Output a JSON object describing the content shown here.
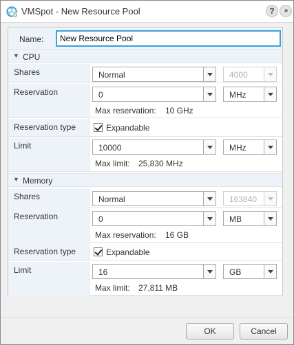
{
  "window": {
    "title": "VMSpot - New Resource Pool",
    "help_label": "?",
    "expand_label": "»"
  },
  "name_field": {
    "label": "Name:",
    "value": "New Resource Pool"
  },
  "cpu": {
    "title": "CPU",
    "shares_label": "Shares",
    "shares_value": "Normal",
    "shares_number": "4000",
    "reservation_label": "Reservation",
    "reservation_value": "0",
    "reservation_unit": "MHz",
    "max_reservation_label": "Max reservation:",
    "max_reservation_value": "10 GHz",
    "reservation_type_label": "Reservation type",
    "expandable_label": "Expandable",
    "expandable_checked": true,
    "limit_label": "Limit",
    "limit_value": "10000",
    "limit_unit": "MHz",
    "max_limit_label": "Max limit:",
    "max_limit_value": "25,830 MHz"
  },
  "memory": {
    "title": "Memory",
    "shares_label": "Shares",
    "shares_value": "Normal",
    "shares_number": "163840",
    "reservation_label": "Reservation",
    "reservation_value": "0",
    "reservation_unit": "MB",
    "max_reservation_label": "Max reservation:",
    "max_reservation_value": "16 GB",
    "reservation_type_label": "Reservation type",
    "expandable_label": "Expandable",
    "expandable_checked": true,
    "limit_label": "Limit",
    "limit_value": "16",
    "limit_unit": "GB",
    "max_limit_label": "Max limit:",
    "max_limit_value": "27,811 MB"
  },
  "footer": {
    "ok_label": "OK",
    "cancel_label": "Cancel"
  },
  "colors": {
    "accent": "#3aa0d9",
    "label_background": "#edf3f8"
  }
}
